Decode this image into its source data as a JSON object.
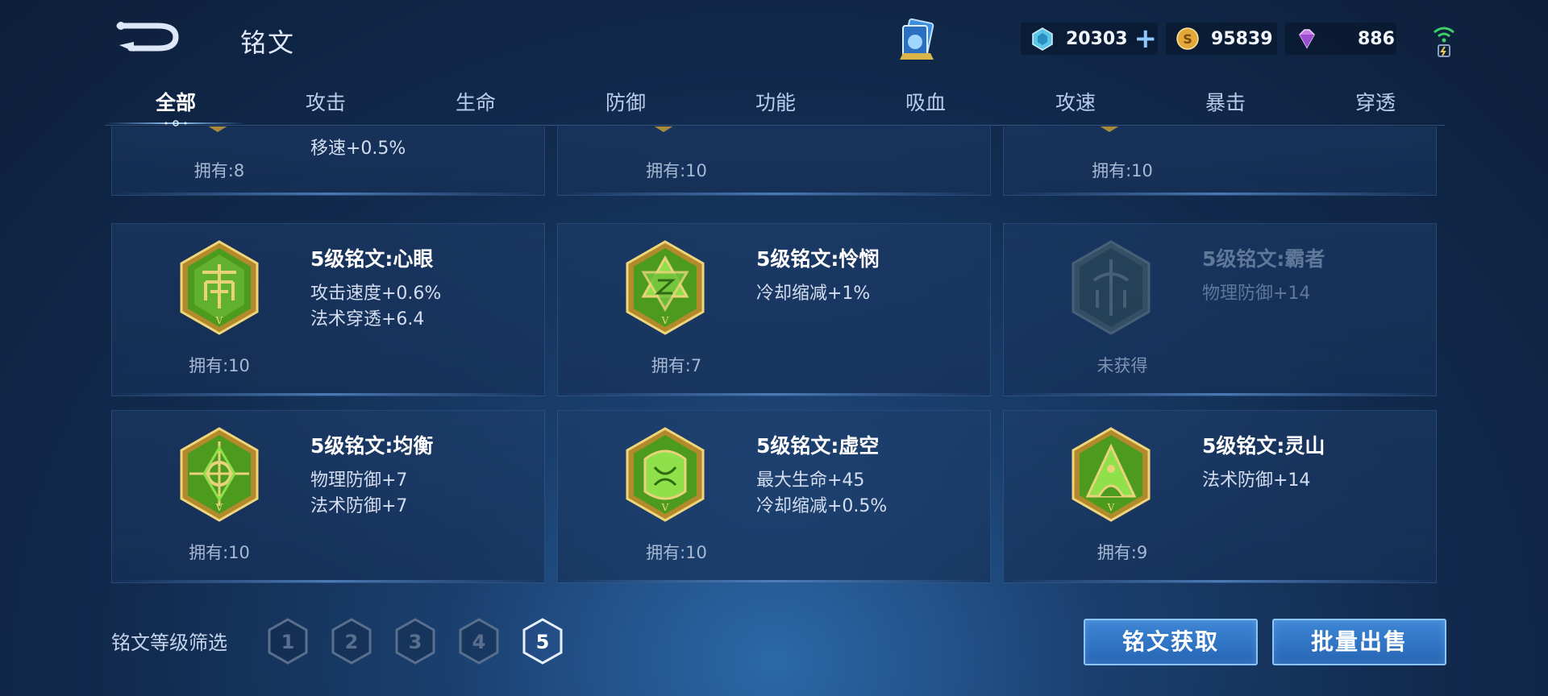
{
  "header": {
    "title": "铭文",
    "currencies": {
      "coupon": "20303",
      "gold": "95839",
      "gem": "886"
    }
  },
  "tabs": [
    {
      "label": "全部",
      "active": true
    },
    {
      "label": "攻击"
    },
    {
      "label": "生命"
    },
    {
      "label": "防御"
    },
    {
      "label": "功能"
    },
    {
      "label": "吸血"
    },
    {
      "label": "攻速"
    },
    {
      "label": "暴击"
    },
    {
      "label": "穿透"
    }
  ],
  "top_row": [
    {
      "stat": "移速+0.5%",
      "owned": "拥有:8"
    },
    {
      "owned": "拥有:10"
    },
    {
      "owned": "拥有:10"
    }
  ],
  "cards": [
    {
      "name": "5级铭文:心眼",
      "stats": [
        "攻击速度+0.6%",
        "法术穿透+6.4"
      ],
      "owned": "拥有:10",
      "icon": "heart-eye-emblem-icon"
    },
    {
      "name": "5级铭文:怜悯",
      "stats": [
        "冷却缩减+1%"
      ],
      "owned": "拥有:7",
      "icon": "compassion-emblem-icon"
    },
    {
      "name": "5级铭文:霸者",
      "stats": [
        "物理防御+14"
      ],
      "owned": "未获得",
      "locked": true,
      "icon": "overlord-emblem-icon"
    },
    {
      "name": "5级铭文:均衡",
      "stats": [
        "物理防御+7",
        "法术防御+7"
      ],
      "owned": "拥有:10",
      "icon": "balance-emblem-icon"
    },
    {
      "name": "5级铭文:虚空",
      "stats": [
        "最大生命+45",
        "冷却缩减+0.5%"
      ],
      "owned": "拥有:10",
      "icon": "void-emblem-icon"
    },
    {
      "name": "5级铭文:灵山",
      "stats": [
        "法术防御+14"
      ],
      "owned": "拥有:9",
      "icon": "spirit-mountain-emblem-icon"
    }
  ],
  "footer": {
    "filter_label": "铭文等级筛选",
    "levels": [
      "1",
      "2",
      "3",
      "4",
      "5"
    ],
    "selected_level": "5",
    "acquire_label": "铭文获取",
    "bulk_sell_label": "批量出售"
  },
  "colors": {
    "emblem_green": "#4c9a1e",
    "emblem_gold": "#d9b54a",
    "button_blue": "#2f74c4",
    "background": "#13305a"
  }
}
